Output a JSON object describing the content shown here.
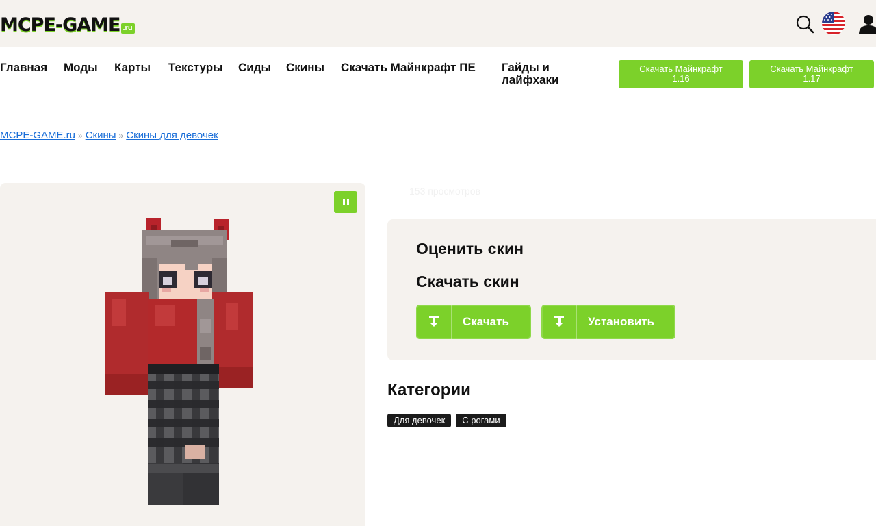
{
  "header": {
    "logo_main": "MCPE-GAME",
    "logo_suffix": ".ru",
    "search_icon": "search-icon",
    "language_icon": "us-flag-icon",
    "user_icon": "user-icon"
  },
  "nav": {
    "items": [
      {
        "label": "Главная"
      },
      {
        "label": "Моды"
      },
      {
        "label": "Карты"
      },
      {
        "label": "Текстуры"
      },
      {
        "label": "Сиды"
      },
      {
        "label": "Скины"
      },
      {
        "label": "Скачать Майнкрафт ПЕ"
      },
      {
        "label": "Гайды и лайфхаки"
      }
    ],
    "download_buttons": [
      {
        "line1": "Скачать Майнкрафт",
        "line2": "1.16"
      },
      {
        "line1": "Скачать Майнкрафт",
        "line2": "1.17"
      }
    ]
  },
  "breadcrumb": {
    "items": [
      "MCPE-GAME.ru",
      "Скины",
      "Скины для девочек"
    ],
    "separator": "»"
  },
  "skin": {
    "views": "153 просмотров",
    "rate_heading": "Оценить скин",
    "download_heading": "Скачать скин",
    "download_label": "Скачать",
    "install_label": "Установить"
  },
  "categories": {
    "heading": "Категории",
    "tags": [
      "Для девочек",
      "С рогами"
    ]
  },
  "colors": {
    "accent": "#7cd12a",
    "panel": "#f5f2ee",
    "link": "#1a6ed8",
    "tag_bg": "#1b1b1b"
  }
}
